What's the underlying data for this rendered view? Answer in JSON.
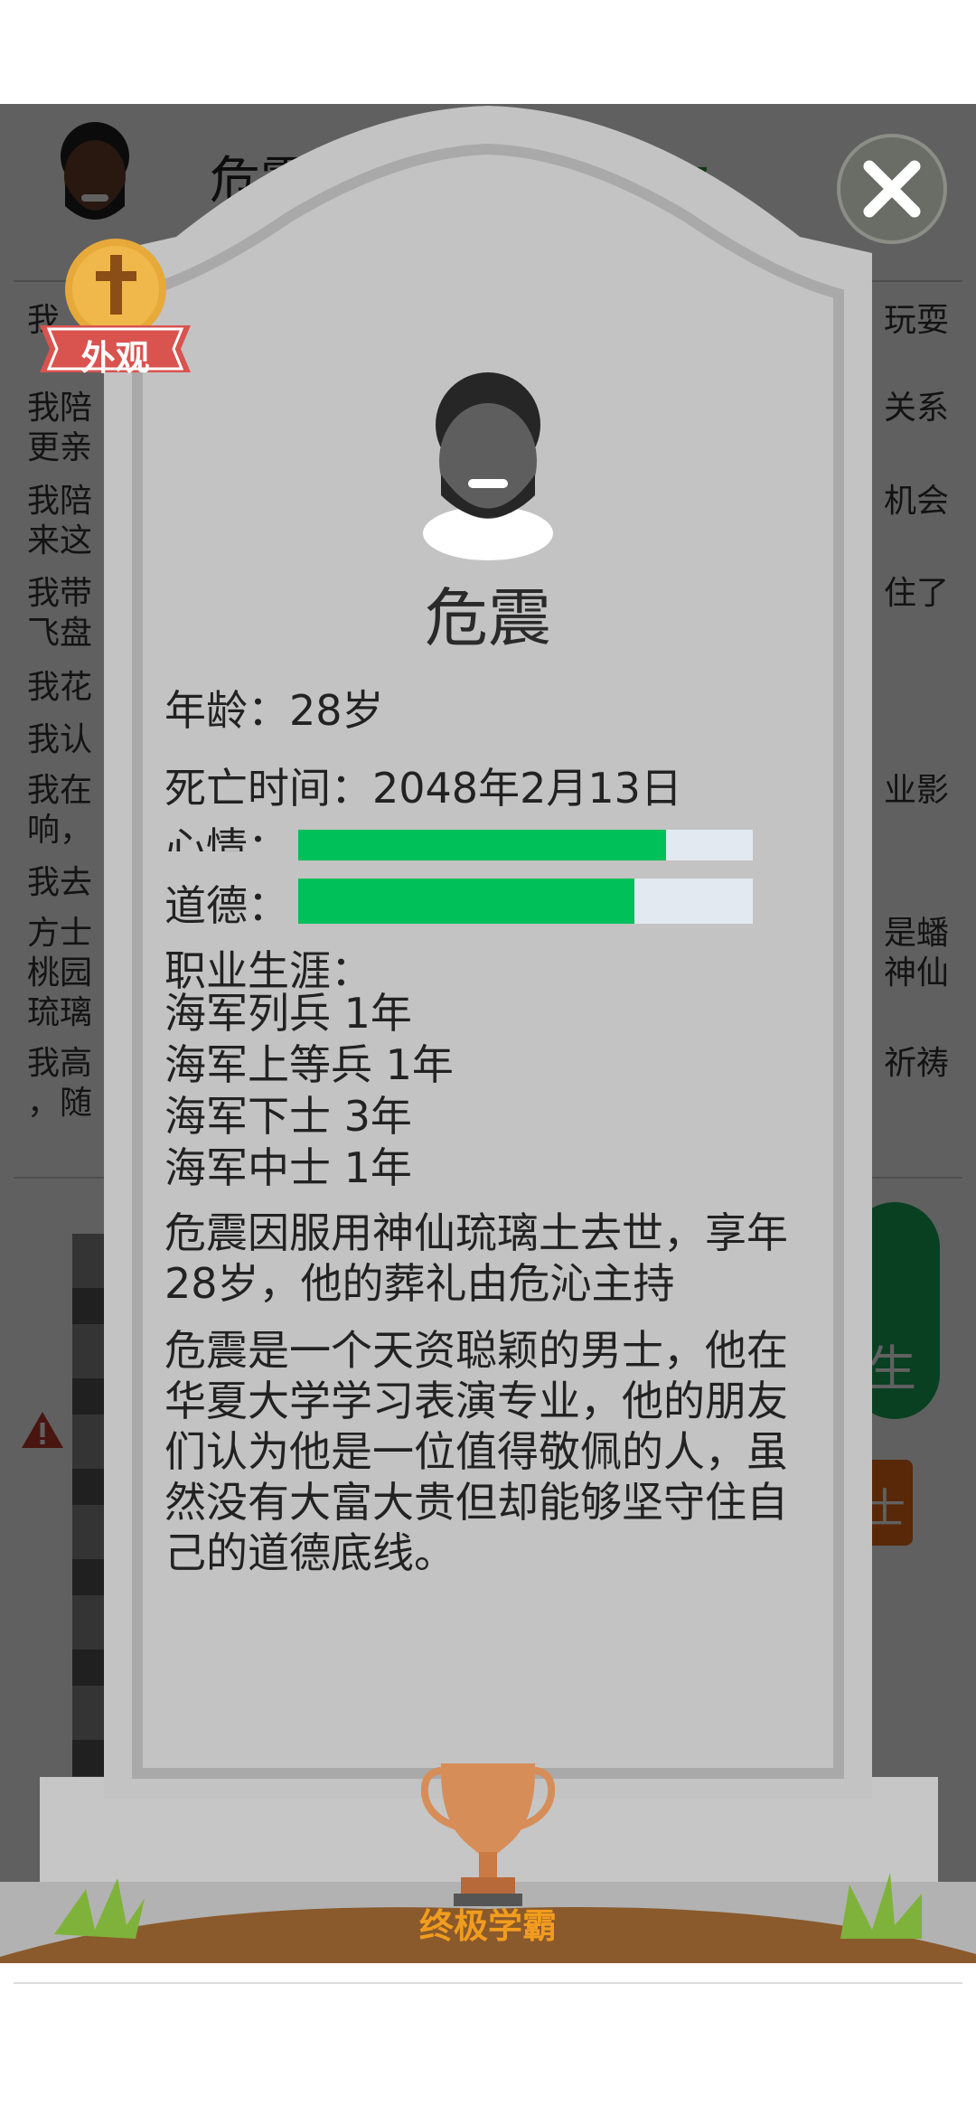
{
  "background": {
    "player_name": "危震",
    "money_partial": "177",
    "log_left": [
      "我",
      "我陪",
      "更亲",
      "我陪",
      "来这",
      "我带",
      "飞盘",
      "我花",
      "我认",
      "我在",
      "响，",
      "我去",
      "方士",
      "桃园",
      "琉璃",
      "我高",
      "，随"
    ],
    "log_right": [
      "玩耍",
      "关系",
      "机会",
      "住了",
      "业影",
      "是蟠",
      "神仙",
      "祈祷"
    ],
    "green_button_partial": "生",
    "orange_button_partial": "士"
  },
  "tombstone": {
    "name": "危震",
    "age": "年龄：28岁",
    "death_time": "死亡时间：2048年2月13日",
    "mood_label": "心情：",
    "mood_fraction": 0.81,
    "morality_label": "道德：",
    "morality_fraction": 0.74,
    "career_title": "职业生涯：",
    "career": [
      "海军列兵 1年",
      "海军上等兵 1年",
      "海军下士 3年",
      "海军中士 1年"
    ],
    "death_text": "危震因服用神仙琉璃土去世，享年28岁，他的葬礼由危沁主持",
    "bio_text": "危震是一个天资聪颖的男士，他在华夏大学学习表演专业，他的朋友们认为他是一位值得敬佩的人，虽然没有大富大贵但却能够坚守住自己的道德底线。",
    "trophy_label": "终极学霸"
  },
  "appearance_badge": {
    "label": "外观"
  },
  "icons": {
    "close": "close-icon",
    "cross": "cross-icon",
    "trophy": "trophy-icon",
    "avatar": "avatar-icon",
    "warning": "warning-icon"
  },
  "colors": {
    "tomb_stone": "#c3c3c3",
    "bar_fill": "#00c05a",
    "bar_track": "#e3e9f1",
    "trophy_text": "#f29c1f",
    "badge_ribbon": "#d9534f",
    "badge_medal": "#e6a93a"
  }
}
